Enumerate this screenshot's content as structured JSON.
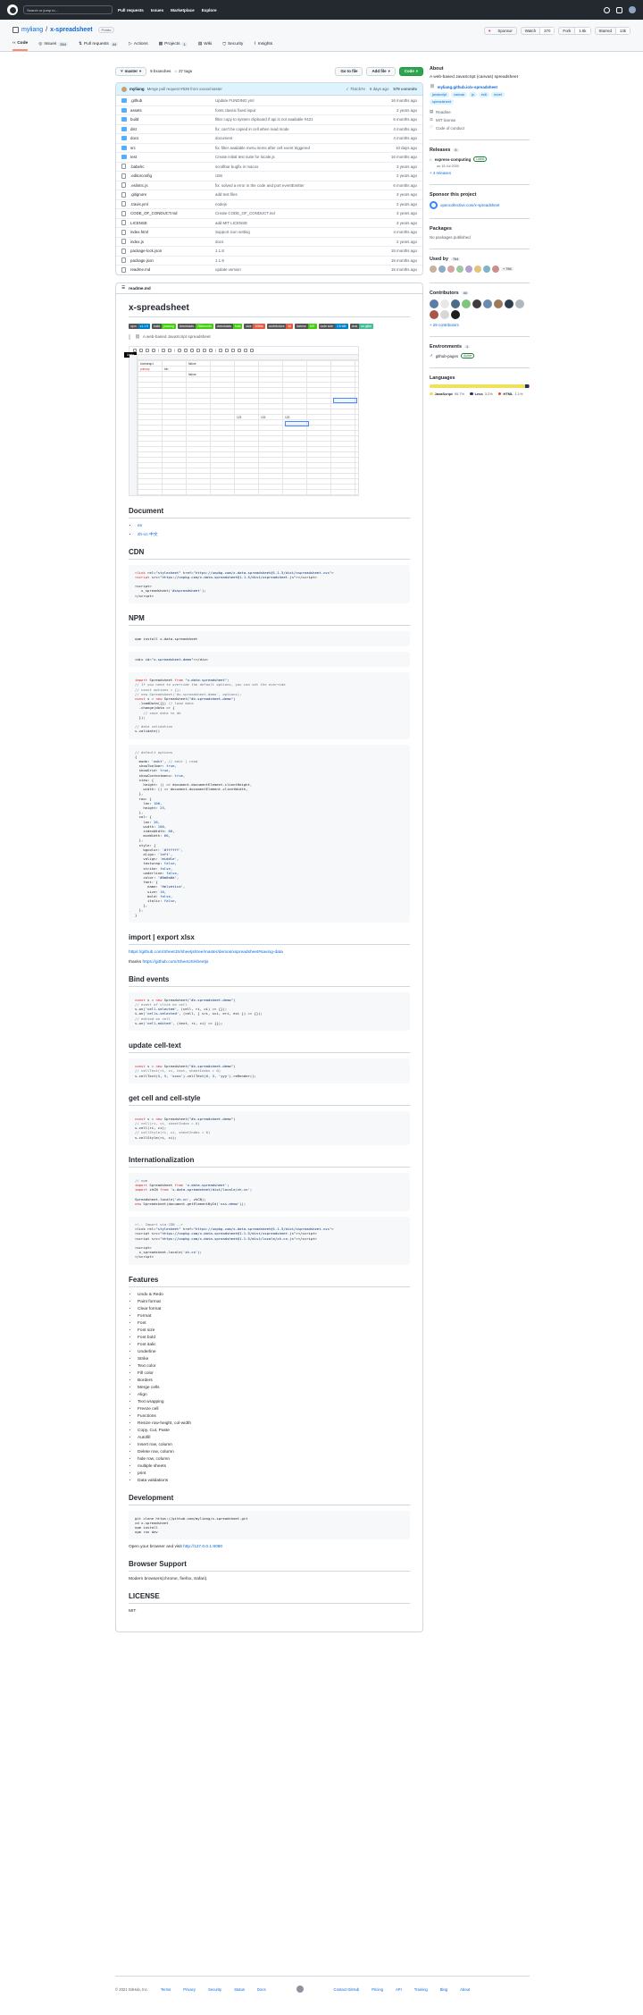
{
  "header": {
    "search_placeholder": "Search or jump to...",
    "nav": [
      "Pull requests",
      "Issues",
      "Marketplace",
      "Explore"
    ]
  },
  "repo": {
    "owner": "myliang",
    "name": "x-spreadsheet",
    "visibility": "Public",
    "actions": [
      {
        "label": "Sponsor",
        "count": ""
      },
      {
        "label": "Watch",
        "count": "370"
      },
      {
        "label": "Fork",
        "count": "1.5k"
      },
      {
        "label": "Starred",
        "count": "13k"
      }
    ],
    "tabs": [
      {
        "label": "Code",
        "count": ""
      },
      {
        "label": "Issues",
        "count": "354"
      },
      {
        "label": "Pull requests",
        "count": "44"
      },
      {
        "label": "Actions",
        "count": ""
      },
      {
        "label": "Projects",
        "count": "1"
      },
      {
        "label": "Wiki",
        "count": ""
      },
      {
        "label": "Security",
        "count": ""
      },
      {
        "label": "Insights",
        "count": ""
      }
    ]
  },
  "toolbar": {
    "branch": "master",
    "branches": "5 branches",
    "tags": "27 tags",
    "goto_file": "Go to file",
    "add_file": "Add file",
    "code": "Code"
  },
  "commit": {
    "author": "myliang",
    "message": "Merge pull request #539 from xxxxx/master",
    "hash": "✓ 7b4cb7e",
    "when": "9 days ago",
    "commits": "579 commits"
  },
  "files": [
    {
      "type": "dir",
      "name": ".github",
      "msg": "Update FUNDING.yml",
      "time": "16 months ago"
    },
    {
      "type": "dir",
      "name": "assets",
      "msg": "fonts classic fixed input",
      "time": "2 years ago"
    },
    {
      "type": "dir",
      "name": "build",
      "msg": "filter copy to system clipboard if api is not available #421",
      "time": "6 months ago"
    },
    {
      "type": "dir",
      "name": "dist",
      "msg": "fix: can't be copied in cell when read mode",
      "time": "4 months ago"
    },
    {
      "type": "dir",
      "name": "docs",
      "msg": "document",
      "time": "4 months ago"
    },
    {
      "type": "dir",
      "name": "src",
      "msg": "fix: filter available menu items after cell event triggered",
      "time": "10 days ago"
    },
    {
      "type": "dir",
      "name": "test",
      "msg": "Create initial test suite for locale.js",
      "time": "16 months ago"
    },
    {
      "type": "file",
      "name": ".babelrc",
      "msg": "scrollbar bugfix in macos",
      "time": "3 years ago"
    },
    {
      "type": "file",
      "name": ".editorconfig",
      "msg": "i18n",
      "time": "2 years ago"
    },
    {
      "type": "file",
      "name": ".eslintrc.js",
      "msg": "fix: solved a error in the code and port eventEmitter",
      "time": "6 months ago"
    },
    {
      "type": "file",
      "name": ".gitignore",
      "msg": "add test files",
      "time": "3 years ago"
    },
    {
      "type": "file",
      "name": ".travis.yml",
      "msg": "nodejs",
      "time": "2 years ago"
    },
    {
      "type": "file",
      "name": "CODE_OF_CONDUCT.md",
      "msg": "Create CODE_OF_CONDUCT.md",
      "time": "3 years ago"
    },
    {
      "type": "file",
      "name": "LICENSE",
      "msg": "add MIT LICENSE",
      "time": "3 years ago"
    },
    {
      "type": "file",
      "name": "index.html",
      "msg": "Support icon setting",
      "time": "4 months ago"
    },
    {
      "type": "file",
      "name": "index.js",
      "msg": "docs",
      "time": "2 years ago"
    },
    {
      "type": "file",
      "name": "package-lock.json",
      "msg": "1.1.8",
      "time": "15 months ago"
    },
    {
      "type": "file",
      "name": "package.json",
      "msg": "1.1.9",
      "time": "15 months ago"
    },
    {
      "type": "file",
      "name": "readme.md",
      "msg": "update version",
      "time": "15 months ago"
    }
  ],
  "readme": {
    "file": "readme.md",
    "title": "x-spreadsheet",
    "badges": [
      {
        "l": "npm",
        "r": "v1.1.9",
        "color": "#007ec6"
      },
      {
        "l": "build",
        "r": "passing",
        "color": "#4c1"
      },
      {
        "l": "downloads",
        "r": "28k/month",
        "color": "#4c1"
      },
      {
        "l": "downloads",
        "r": "total",
        "color": "#4c1"
      },
      {
        "l": "size",
        "r": "106kb",
        "color": "#e05d44"
      },
      {
        "l": "contributors",
        "r": "40",
        "color": "#e05d44"
      },
      {
        "l": "license",
        "r": "MIT",
        "color": "#4c1"
      },
      {
        "l": "code size",
        "r": "2.8 MB",
        "color": "#007ec6"
      },
      {
        "l": "chat",
        "r": "on gitter",
        "color": "#46bc99"
      }
    ],
    "blurb": "A web-based JavaScript spreadsheet",
    "sheet": {
      "tooltip": "Undo",
      "cells": [
        "bootstrap1",
        "primary",
        "btn",
        "failure",
        "failure",
        "123",
        "123",
        "123"
      ]
    },
    "sections": {
      "document": "Document",
      "docs": [
        "en",
        "zh-cn 中文"
      ],
      "cdn": "CDN",
      "npm": "NPM",
      "import_export": "import | export xlsx",
      "import_link": "https://github.com/SheetJS/sheetjs/tree/master/demos/xspreadsheet#saving-data",
      "thanks_label": "thanks",
      "thanks_link": "https://github.com/SheetJS/sheetjs",
      "bind_events": "Bind events",
      "update_cell": "update cell-text",
      "get_cell": "get cell and cell-style",
      "i18n": "Internationalization",
      "features": "Features",
      "development": "Development",
      "dev_open": "Open your browser and visit",
      "dev_url": "http://127.0.0.1:8080",
      "browser": "Browser Support",
      "browser_text": "Modern browsers(chrome, firefox, Safari).",
      "license": "LICENSE",
      "license_text": "MIT"
    },
    "features": [
      "Undo & Redo",
      "Paint format",
      "Clear format",
      "Format",
      "Font",
      "Font size",
      "Font bold",
      "Font italic",
      "Underline",
      "Strike",
      "Text color",
      "Fill color",
      "Borders",
      "Merge cells",
      "Align",
      "Text wrapping",
      "Freeze cell",
      "Functions",
      "Resize row-height, col-width",
      "Copy, Cut, Paste",
      "Autofill",
      "Insert row, column",
      "Delete row, column",
      "hide row, column",
      "multiple sheets",
      "print",
      "Data validations"
    ]
  },
  "sidebar": {
    "about_h": "About",
    "about": "A web-based JavaScript (canvas) spreadsheet",
    "homepage": "myliang.github.io/x-spreadsheet",
    "topics": [
      "javascript",
      "canvas",
      "js",
      "es6",
      "excel",
      "spreadsheet"
    ],
    "items": [
      "Readme",
      "MIT license",
      "Code of conduct"
    ],
    "releases_h": "Releases",
    "releases_count": "5",
    "release_name": "express-computing",
    "release_tag": "Latest",
    "release_date": "on 15 Jul 2020",
    "release_more": "+ 4 releases",
    "sponsor_h": "Sponsor this project",
    "sponsor_link": "opencollective.com/x-spreadsheet",
    "packages_h": "Packages",
    "packages_text": "No packages published",
    "usedby_h": "Used by",
    "usedby_count": "764",
    "usedby_more": "+ 756",
    "contrib_h": "Contributors",
    "contrib_count": "40",
    "contrib_more": "+ 29 contributors",
    "env_h": "Environments",
    "env_count": "1",
    "env_name": "github-pages",
    "env_status": "Active",
    "lang_h": "Languages",
    "languages": [
      {
        "name": "JavaScript",
        "pct": "95.7%",
        "value": 95.7,
        "color": "#f1e05a"
      },
      {
        "name": "Less",
        "pct": "3.2%",
        "value": 3.2,
        "color": "#1d365d"
      },
      {
        "name": "HTML",
        "pct": "1.1%",
        "value": 1.1,
        "color": "#e34c26"
      }
    ]
  },
  "footer": {
    "copyright": "© 2021 GitHub, Inc.",
    "left": [
      "Terms",
      "Privacy",
      "Security",
      "Status",
      "Docs"
    ],
    "right": [
      "Contact GitHub",
      "Pricing",
      "API",
      "Training",
      "Blog",
      "About"
    ]
  }
}
